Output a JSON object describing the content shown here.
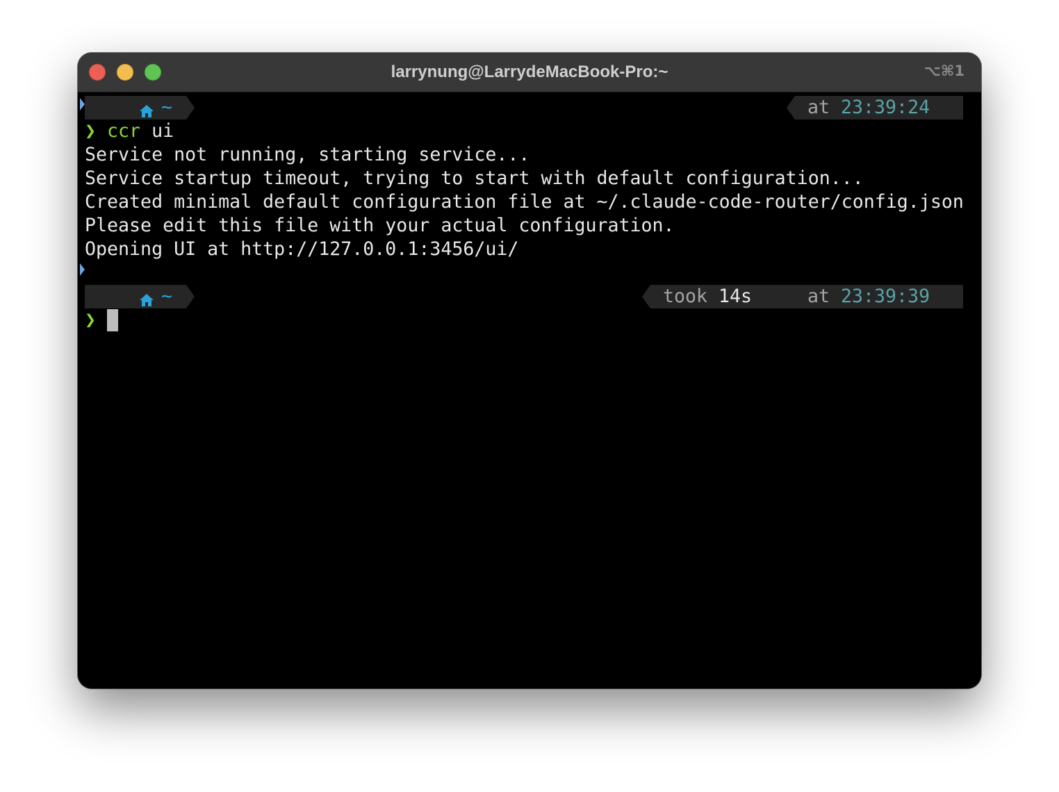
{
  "window": {
    "title": "larrynung@LarrydeMacBook-Pro:~",
    "shortcut": "⌥⌘1"
  },
  "colors": {
    "titlebar": "#383838",
    "terminal_bg": "#000000",
    "prompt_green": "#8cd633",
    "path_blue": "#2aa2d8",
    "time_teal": "#59a3a8",
    "segment_bg": "#262626"
  },
  "prompt1": {
    "os_icon": "apple-icon",
    "home_icon": "home-icon",
    "path": "~",
    "time_prefix": "at",
    "time": "23:39:24",
    "clock_icon": "clock-icon"
  },
  "command": {
    "symbol": "❯",
    "text": "ccr",
    "arg": "ui"
  },
  "output": [
    "Service not running, starting service...",
    "Service startup timeout, trying to start with default configuration...",
    "Created minimal default configuration file at ~/.claude-code-router/config.json",
    "Please edit this file with your actual configuration.",
    "Opening UI at http://127.0.0.1:3456/ui/"
  ],
  "prompt2": {
    "os_icon": "apple-icon",
    "home_icon": "home-icon",
    "path": "~",
    "took_prefix": "took",
    "duration": "14s",
    "hourglass_icon": "hourglass-icon",
    "time_prefix": "at",
    "time": "23:39:39",
    "clock_icon": "clock-icon",
    "symbol": "❯"
  }
}
